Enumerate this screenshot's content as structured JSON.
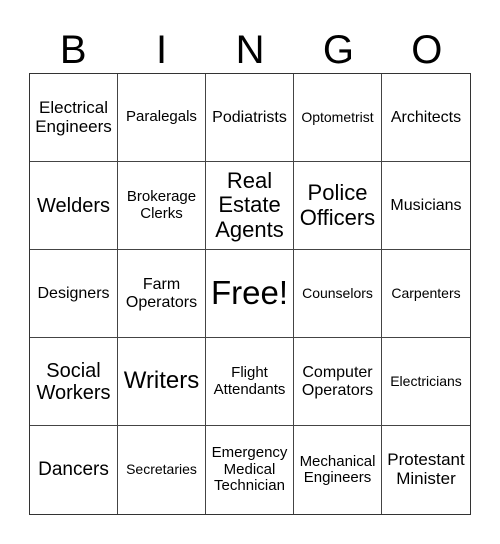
{
  "header": [
    "B",
    "I",
    "N",
    "G",
    "O"
  ],
  "rows": [
    [
      "Electrical Engineers",
      "Paralegals",
      "Podiatrists",
      "Optometrist",
      "Architects"
    ],
    [
      "Welders",
      "Brokerage Clerks",
      "Real Estate Agents",
      "Police Officers",
      "Musicians"
    ],
    [
      "Designers",
      "Farm Operators",
      "Free!",
      "Counselors",
      "Carpenters"
    ],
    [
      "Social Workers",
      "Writers",
      "Flight Attendants",
      "Computer Operators",
      "Electricians"
    ],
    [
      "Dancers",
      "Secretaries",
      "Emergency Medical Technician",
      "Mechanical Engineers",
      "Protestant Minister"
    ]
  ]
}
